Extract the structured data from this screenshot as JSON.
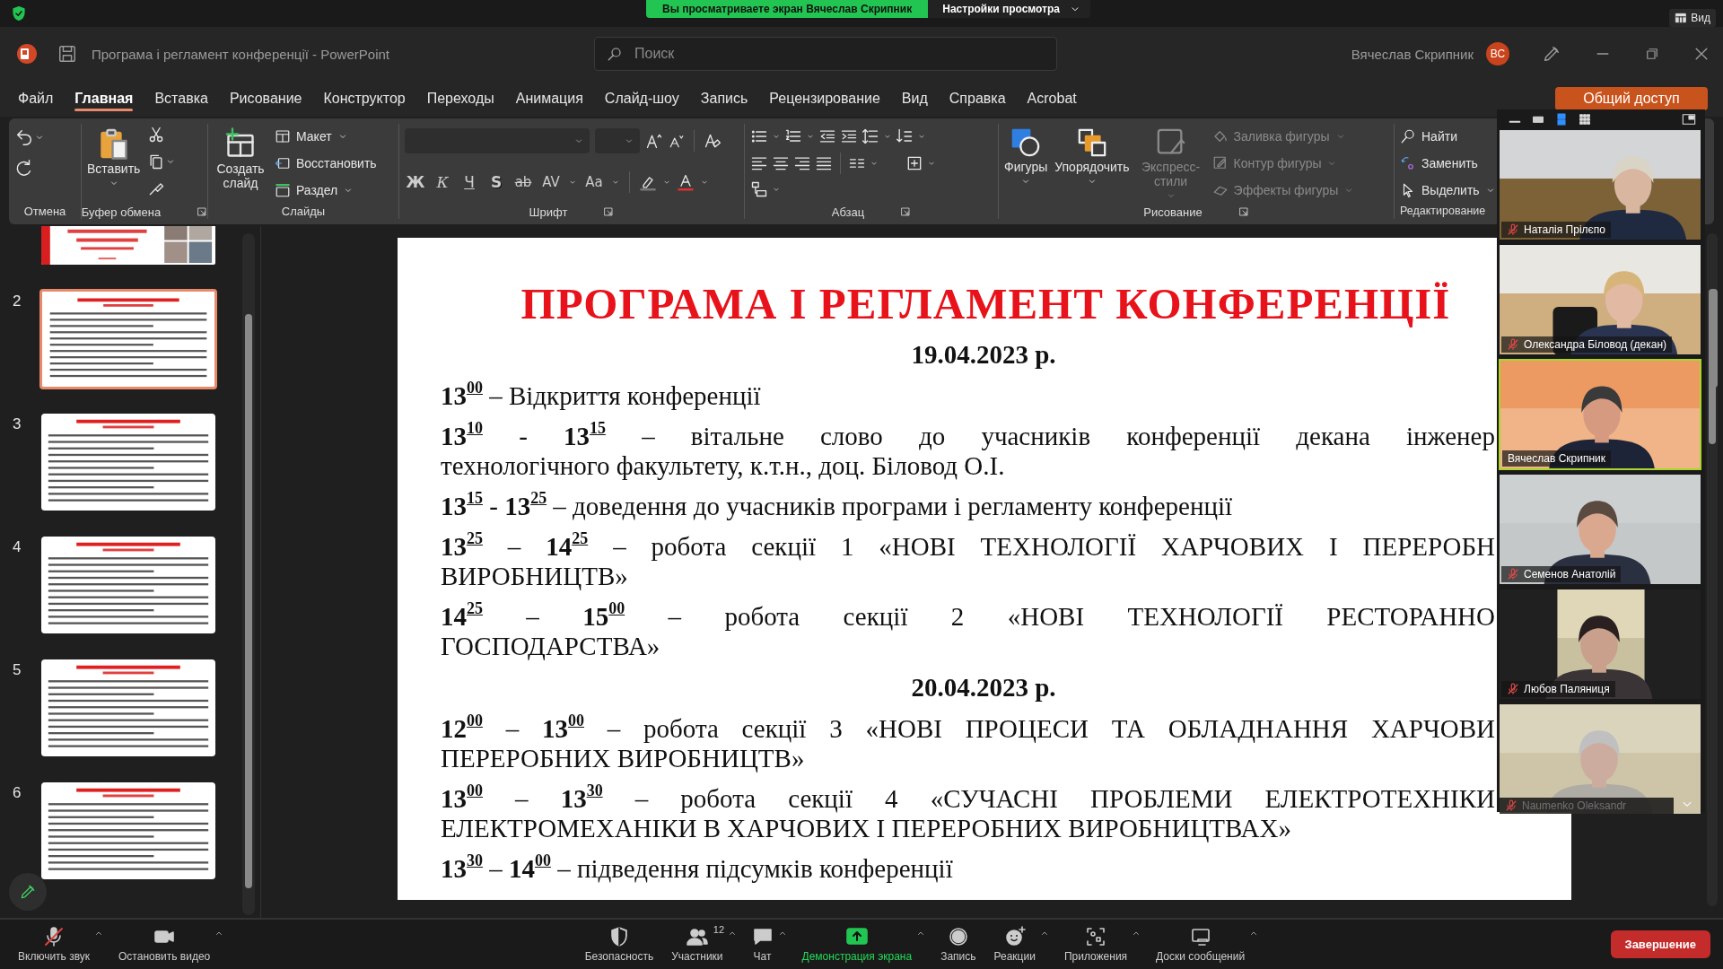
{
  "zoom_bar": {
    "sharing_notice": "Вы просматриваете экран Вячеслав Скрипник",
    "view_options": "Настройки просмотра",
    "view_button": "Вид"
  },
  "window": {
    "title": "Програма і регламент конференції  -  PowerPoint",
    "search_placeholder": "Поиск",
    "user": "Вячеслав Скрипник",
    "avatar": "ВС"
  },
  "tabs": [
    {
      "label": "Файл",
      "selected": false
    },
    {
      "label": "Главная",
      "selected": true
    },
    {
      "label": "Вставка",
      "selected": false
    },
    {
      "label": "Рисование",
      "selected": false
    },
    {
      "label": "Конструктор",
      "selected": false
    },
    {
      "label": "Переходы",
      "selected": false
    },
    {
      "label": "Анимация",
      "selected": false
    },
    {
      "label": "Слайд-шоу",
      "selected": false
    },
    {
      "label": "Запись",
      "selected": false
    },
    {
      "label": "Рецензирование",
      "selected": false
    },
    {
      "label": "Вид",
      "selected": false
    },
    {
      "label": "Справка",
      "selected": false
    },
    {
      "label": "Acrobat",
      "selected": false
    }
  ],
  "share_button": "Общий доступ",
  "ribbon": {
    "undo": {
      "label": "Отмена"
    },
    "clipboard": {
      "label": "Буфер обмена",
      "paste": "Вставить"
    },
    "slides": {
      "label": "Слайды",
      "new_slide": "Создать слайд",
      "commands": [
        "Макет",
        "Восстановить",
        "Раздел"
      ]
    },
    "font": {
      "label": "Шрифт",
      "buttons": [
        "Ж",
        "К",
        "Ч",
        "S",
        "ab",
        "AV",
        "Aa"
      ]
    },
    "paragraph": {
      "label": "Абзац"
    },
    "drawing": {
      "label": "Рисование",
      "shapes": "Фигуры",
      "arrange": "Упорядочить",
      "quick_styles": {
        "label": "Экспресс-стили",
        "disabled": true
      },
      "commands": [
        {
          "label": "Заливка фигуры",
          "disabled": true
        },
        {
          "label": "Контур фигуры",
          "disabled": true
        },
        {
          "label": "Эффекты фигуры",
          "disabled": true
        }
      ]
    },
    "editing": {
      "label": "Редактирование",
      "commands": [
        "Найти",
        "Заменить",
        "Выделить"
      ]
    }
  },
  "thumbnails": [
    {
      "kind": "title",
      "selected": false
    },
    {
      "kind": "text",
      "number": "2",
      "selected": true
    },
    {
      "kind": "text",
      "number": "3",
      "selected": false
    },
    {
      "kind": "text",
      "number": "4",
      "selected": false
    },
    {
      "kind": "text",
      "number": "5",
      "selected": false
    },
    {
      "kind": "text",
      "number": "6",
      "selected": false
    }
  ],
  "slide": {
    "title": "ПРОГРАМА І РЕГЛАМЕНТ КОНФЕРЕНЦІЇ",
    "blocks": [
      {
        "kind": "date",
        "lines": [
          "19.04.2023 р."
        ]
      },
      {
        "kind": "item",
        "lines": [
          "**13**$^{00}$ – Відкриття конференції"
        ]
      },
      {
        "kind": "item",
        "lines": [
          "**13**$^{10}$ - **13**$^{15}$ – вітальне слово до учасників конференції декана інженер",
          "технологічного факультету, к.т.н., доц. Біловод О.І."
        ]
      },
      {
        "kind": "item",
        "lines": [
          "**13**$^{15}$ - **13**$^{25}$ – доведення до учасників програми і регламенту конференції"
        ]
      },
      {
        "kind": "item",
        "lines": [
          "**13**$^{25}$ – **14**$^{25}$ – робота секції 1 «НОВІ ТЕХНОЛОГІЇ ХАРЧОВИХ І ПЕРЕРОБН",
          "ВИРОБНИЦТВ»"
        ]
      },
      {
        "kind": "item",
        "lines": [
          "**14**$^{25}$ – **15**$^{00}$ – робота секції 2 «НОВІ ТЕХНОЛОГІЇ РЕСТОРАННО",
          "ГОСПОДАРСТВА»"
        ]
      },
      {
        "kind": "date",
        "lines": [
          "20.04.2023 р."
        ]
      },
      {
        "kind": "item",
        "lines": [
          "**12**$^{00}$ – **13**$^{00}$ – робота секції 3 «НОВІ ПРОЦЕСИ ТА ОБЛАДНАННЯ ХАРЧОВИ",
          "ПЕРЕРОБНИХ ВИРОБНИЦТВ»"
        ]
      },
      {
        "kind": "item",
        "lines": [
          "**13**$^{00}$ – **13**$^{30}$ – робота секції 4 «СУЧАСНІ ПРОБЛЕМИ ЕЛЕКТРОТЕХНІКИ",
          "ЕЛЕКТРОМЕХАНІКИ В ХАРЧОВИХ І ПЕРЕРОБНИХ ВИРОБНИЦТВАХ»"
        ]
      },
      {
        "kind": "item",
        "lines": [
          "**13**$^{30}$ – **14**$^{00}$ – підведення підсумків конференції"
        ]
      }
    ]
  },
  "participants": [
    {
      "name": "Наталія Прілєпо",
      "muted": true,
      "speaking": false
    },
    {
      "name": "Олександра Біловод (декан)",
      "muted": true,
      "speaking": false
    },
    {
      "name": "Вячеслав Скрипник",
      "muted": false,
      "speaking": true
    },
    {
      "name": "Семенов Анатолій",
      "muted": true,
      "speaking": false
    },
    {
      "name": "Любов Паляниця",
      "muted": true,
      "speaking": false
    },
    {
      "name": "Naumenko Oleksandr",
      "muted": true,
      "speaking": false
    }
  ],
  "toolbar": [
    {
      "kind": "mic",
      "label": "Включить звук",
      "menu": true,
      "active": false
    },
    {
      "kind": "video",
      "label": "Остановить видео",
      "menu": true,
      "active": false
    },
    {
      "kind": "security",
      "label": "Безопасность",
      "menu": false,
      "active": false
    },
    {
      "kind": "participants",
      "label": "Участники",
      "badge": "12",
      "menu": true,
      "active": false
    },
    {
      "kind": "chat",
      "label": "Чат",
      "menu": true,
      "active": false
    },
    {
      "kind": "share",
      "label": "Демонстрация экрана",
      "menu": true,
      "active": true
    },
    {
      "kind": "record",
      "label": "Запись",
      "menu": false,
      "active": false
    },
    {
      "kind": "reactions",
      "label": "Реакции",
      "menu": true,
      "active": false
    },
    {
      "kind": "apps",
      "label": "Приложения",
      "menu": true,
      "active": false
    },
    {
      "kind": "boards",
      "label": "Доски сообщений",
      "menu": true,
      "active": false
    }
  ],
  "end_button": "Завершение"
}
